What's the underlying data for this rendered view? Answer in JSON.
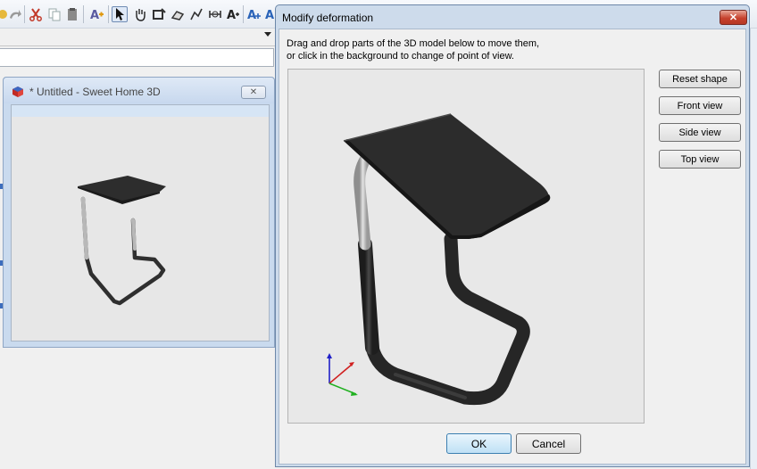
{
  "app": {
    "toolbar_icons": [
      "cut-icon",
      "copy-icon",
      "paste-icon",
      "add-furniture-icon",
      "select-icon",
      "pan-icon",
      "create-walls-icon",
      "create-rooms-icon",
      "create-polylines-icon",
      "create-dimensions-icon",
      "add-text-icon",
      "zoom-in-icon",
      "zoom-out-icon"
    ],
    "colors": {
      "titlebar": "#c7d8ee",
      "close_red": "#c7432f",
      "model": "#2f2f2f",
      "metal": "#b8b8b8"
    }
  },
  "small_window": {
    "title": "* Untitled - Sweet Home 3D",
    "close_symbol": "✕"
  },
  "dialog": {
    "title": "Modify deformation",
    "close_symbol": "✕",
    "instructions_line1": "Drag and drop parts of the 3D model below to move them,",
    "instructions_line2": "or click in the background to change of point of view.",
    "buttons": {
      "reset_shape": "Reset shape",
      "front_view": "Front view",
      "side_view": "Side view",
      "top_view": "Top view",
      "ok": "OK",
      "cancel": "Cancel"
    }
  }
}
